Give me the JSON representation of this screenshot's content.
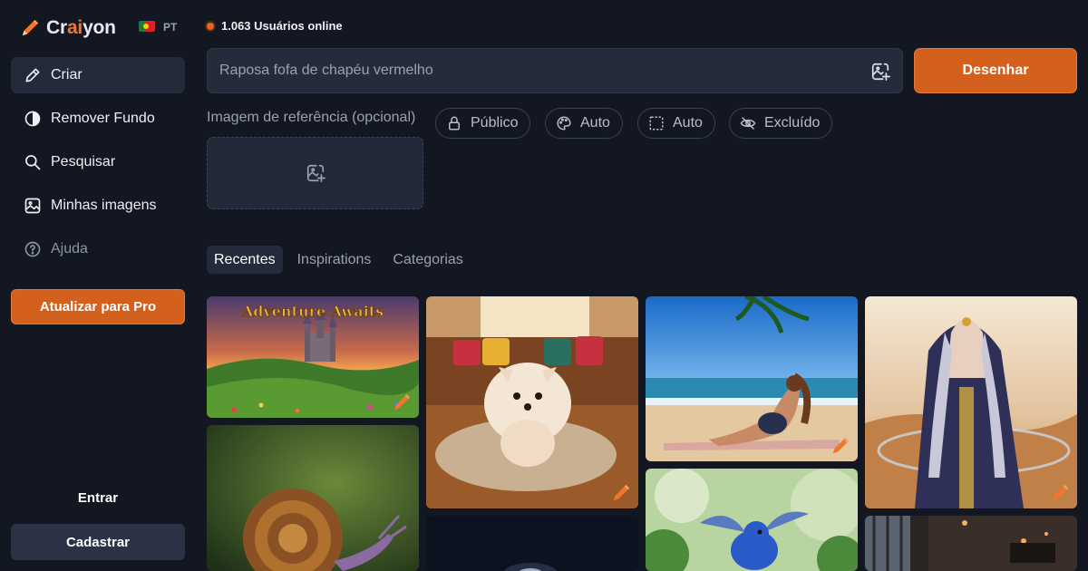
{
  "brand": {
    "name_pre": "Cr",
    "name_accent": "ai",
    "name_post": "yon",
    "accent_color": "#f0762a"
  },
  "language": {
    "code": "PT",
    "flag": "portugal-flag"
  },
  "status": {
    "online_text": "1.063 Usuários online"
  },
  "sidebar": {
    "items": [
      {
        "label": "Criar",
        "icon": "pencil-icon",
        "active": true
      },
      {
        "label": "Remover Fundo",
        "icon": "contrast-icon"
      },
      {
        "label": "Pesquisar",
        "icon": "search-icon"
      },
      {
        "label": "Minhas imagens",
        "icon": "image-icon"
      },
      {
        "label": "Ajuda",
        "icon": "help-icon",
        "muted": true
      }
    ],
    "upgrade_label": "Atualizar para Pro",
    "login_label": "Entrar",
    "signup_label": "Cadastrar"
  },
  "prompt": {
    "placeholder": "Raposa fofa de chapéu vermelho",
    "value": ""
  },
  "draw_button": "Desenhar",
  "reference": {
    "label": "Imagem de referência (opcional)",
    "chips": [
      {
        "label": "Público",
        "icon": "lock-icon"
      },
      {
        "label": "Auto",
        "icon": "palette-icon"
      },
      {
        "label": "Auto",
        "icon": "aspect-ratio-icon"
      },
      {
        "label": "Excluído",
        "icon": "eye-off-icon"
      }
    ]
  },
  "tabs": [
    {
      "label": "Recentes",
      "active": true
    },
    {
      "label": "Inspirations"
    },
    {
      "label": "Categorias"
    }
  ],
  "gallery": {
    "images": [
      {
        "name": "castle-landscape",
        "caption": "Adventure Awaits"
      },
      {
        "name": "snail"
      },
      {
        "name": "pomeranian-dog"
      },
      {
        "name": "dark-space"
      },
      {
        "name": "woman-beach"
      },
      {
        "name": "bluebird"
      },
      {
        "name": "hooded-anime-girl-desert"
      },
      {
        "name": "dark-interior"
      }
    ]
  },
  "colors": {
    "accent": "#d4601e",
    "background": "#131722",
    "surface": "#252b3b"
  }
}
